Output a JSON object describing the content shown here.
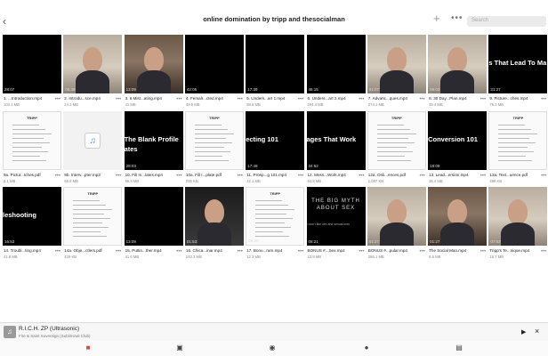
{
  "header": {
    "title": "online domination by tripp and thesocialman",
    "back_icon": "chevron-left-icon",
    "search_placeholder": "Search"
  },
  "files": [
    {
      "name": "1. ...Introduction.mp4",
      "size": "103.1 MB",
      "duration": "28:07",
      "kind": "black"
    },
    {
      "name": "2. Introdu...sce.mp4",
      "size": "24.3 MB",
      "duration": "05:49",
      "kind": "face lite"
    },
    {
      "name": "3. 6 Mist...ating.mp4",
      "size": "41 MB",
      "duration": "13:09",
      "kind": "face"
    },
    {
      "name": "4. Femalr...cted.mp4",
      "size": "49.5 MB",
      "duration": "42:05",
      "kind": "black"
    },
    {
      "name": "5. Unders...art 1.mp4",
      "size": "89.6 MB",
      "duration": "17:39",
      "kind": "black"
    },
    {
      "name": "6. Unders...art 2.mp4",
      "size": "204.4 MB",
      "duration": "46:15",
      "kind": "black"
    },
    {
      "name": "7. Advanc...ques.mp4",
      "size": "274.1 MB",
      "duration": "01:07:12",
      "kind": "face lite"
    },
    {
      "name": "8. 30 Day...Plan.mp4",
      "size": "35.4 MB",
      "duration": "09:03",
      "kind": "face lite"
    },
    {
      "name": "9. Picture...ches.mp4",
      "size": "75.3 MB",
      "duration": "31:27",
      "kind": "black",
      "text": "s That Lead To Ma"
    },
    {
      "name": "9a. Pictur...tches.pdf",
      "size": "2.1 MB",
      "duration": "",
      "kind": "doc"
    },
    {
      "name": "9b. Interv...pter.mp3",
      "size": "95.5 MB",
      "duration": "",
      "kind": "audio"
    },
    {
      "name": "10. Fill In...lates.mp4",
      "size": "56.8 MB",
      "duration": "28:03",
      "kind": "black",
      "text": "The Blank Profile",
      "text2": "ates"
    },
    {
      "name": "10a. Fill I...plate.pdf",
      "size": "255 KB",
      "duration": "",
      "kind": "doc"
    },
    {
      "name": "11. Prosp...g 101.mp4",
      "size": "42.1 MB",
      "duration": "17:49",
      "kind": "black",
      "text": "ecting 101"
    },
    {
      "name": "12. Mess...Work.mp4",
      "size": "94.8 MB",
      "duration": "34:52",
      "kind": "black",
      "text": "ages That Work"
    },
    {
      "name": "12a. Onli...ences.pdf",
      "size": "1,067 KB",
      "duration": "",
      "kind": "doc"
    },
    {
      "name": "13. Lead...ersion.mp4",
      "size": "36.4 MB",
      "duration": "18:09",
      "kind": "black",
      "text": "Conversion 101"
    },
    {
      "name": "13a. Text...uence.pdf",
      "size": "489 KB",
      "duration": "",
      "kind": "doc"
    },
    {
      "name": "14. Troubl...ting.mp4",
      "size": "41.8 MB",
      "duration": "16:53",
      "kind": "black",
      "text": "leshooting"
    },
    {
      "name": "14a. Obje...ctlers.pdf",
      "size": "429 KB",
      "duration": "",
      "kind": "doc"
    },
    {
      "name": "15. Puttin...ther.mp4",
      "size": "41.6 MB",
      "duration": "13:09",
      "kind": "black"
    },
    {
      "name": "16. Chica...inar.mp4",
      "size": "243.3 MB",
      "duration": "01:53:21",
      "kind": "face dark"
    },
    {
      "name": "17. Bonu...ram.mp4",
      "size": "12.3 MB",
      "duration": "05:29",
      "kind": "doc"
    },
    {
      "name": "BONUS #...Sex.mp4",
      "size": "23.8 MB",
      "duration": "08:21",
      "kind": "myth"
    },
    {
      "name": "BONUS #...pular.mp4",
      "size": "286.1 MB",
      "duration": "01:27:46",
      "kind": "face lite"
    },
    {
      "name": "The Social Man.mp4",
      "size": "6.6 MB",
      "duration": "01:27",
      "kind": "face"
    },
    {
      "name": "Tripp's Te...nique.mp4",
      "size": "16.7 MB",
      "duration": "07:03",
      "kind": "face lite"
    }
  ],
  "doc_header": "TRIPP",
  "myth_title": "THE BIG MYTH ABOUT SEX",
  "myth_sub": "n don't like sex and sexual men",
  "player": {
    "track": "R.I.C.H. ZP (Ultrasonic)",
    "artist": "Fire & Saint Sovereign (Subliminal Club)",
    "art_icon": "music-note-icon"
  },
  "tabs": [
    {
      "name": "files",
      "icon": "folder-icon",
      "active": true
    },
    {
      "name": "photos",
      "icon": "photo-icon"
    },
    {
      "name": "player",
      "icon": "play-circle-icon"
    },
    {
      "name": "chat",
      "icon": "chat-icon"
    },
    {
      "name": "media",
      "icon": "film-icon"
    }
  ],
  "colors": {
    "accent": "#e0443a",
    "tile_bg": "#000000"
  }
}
